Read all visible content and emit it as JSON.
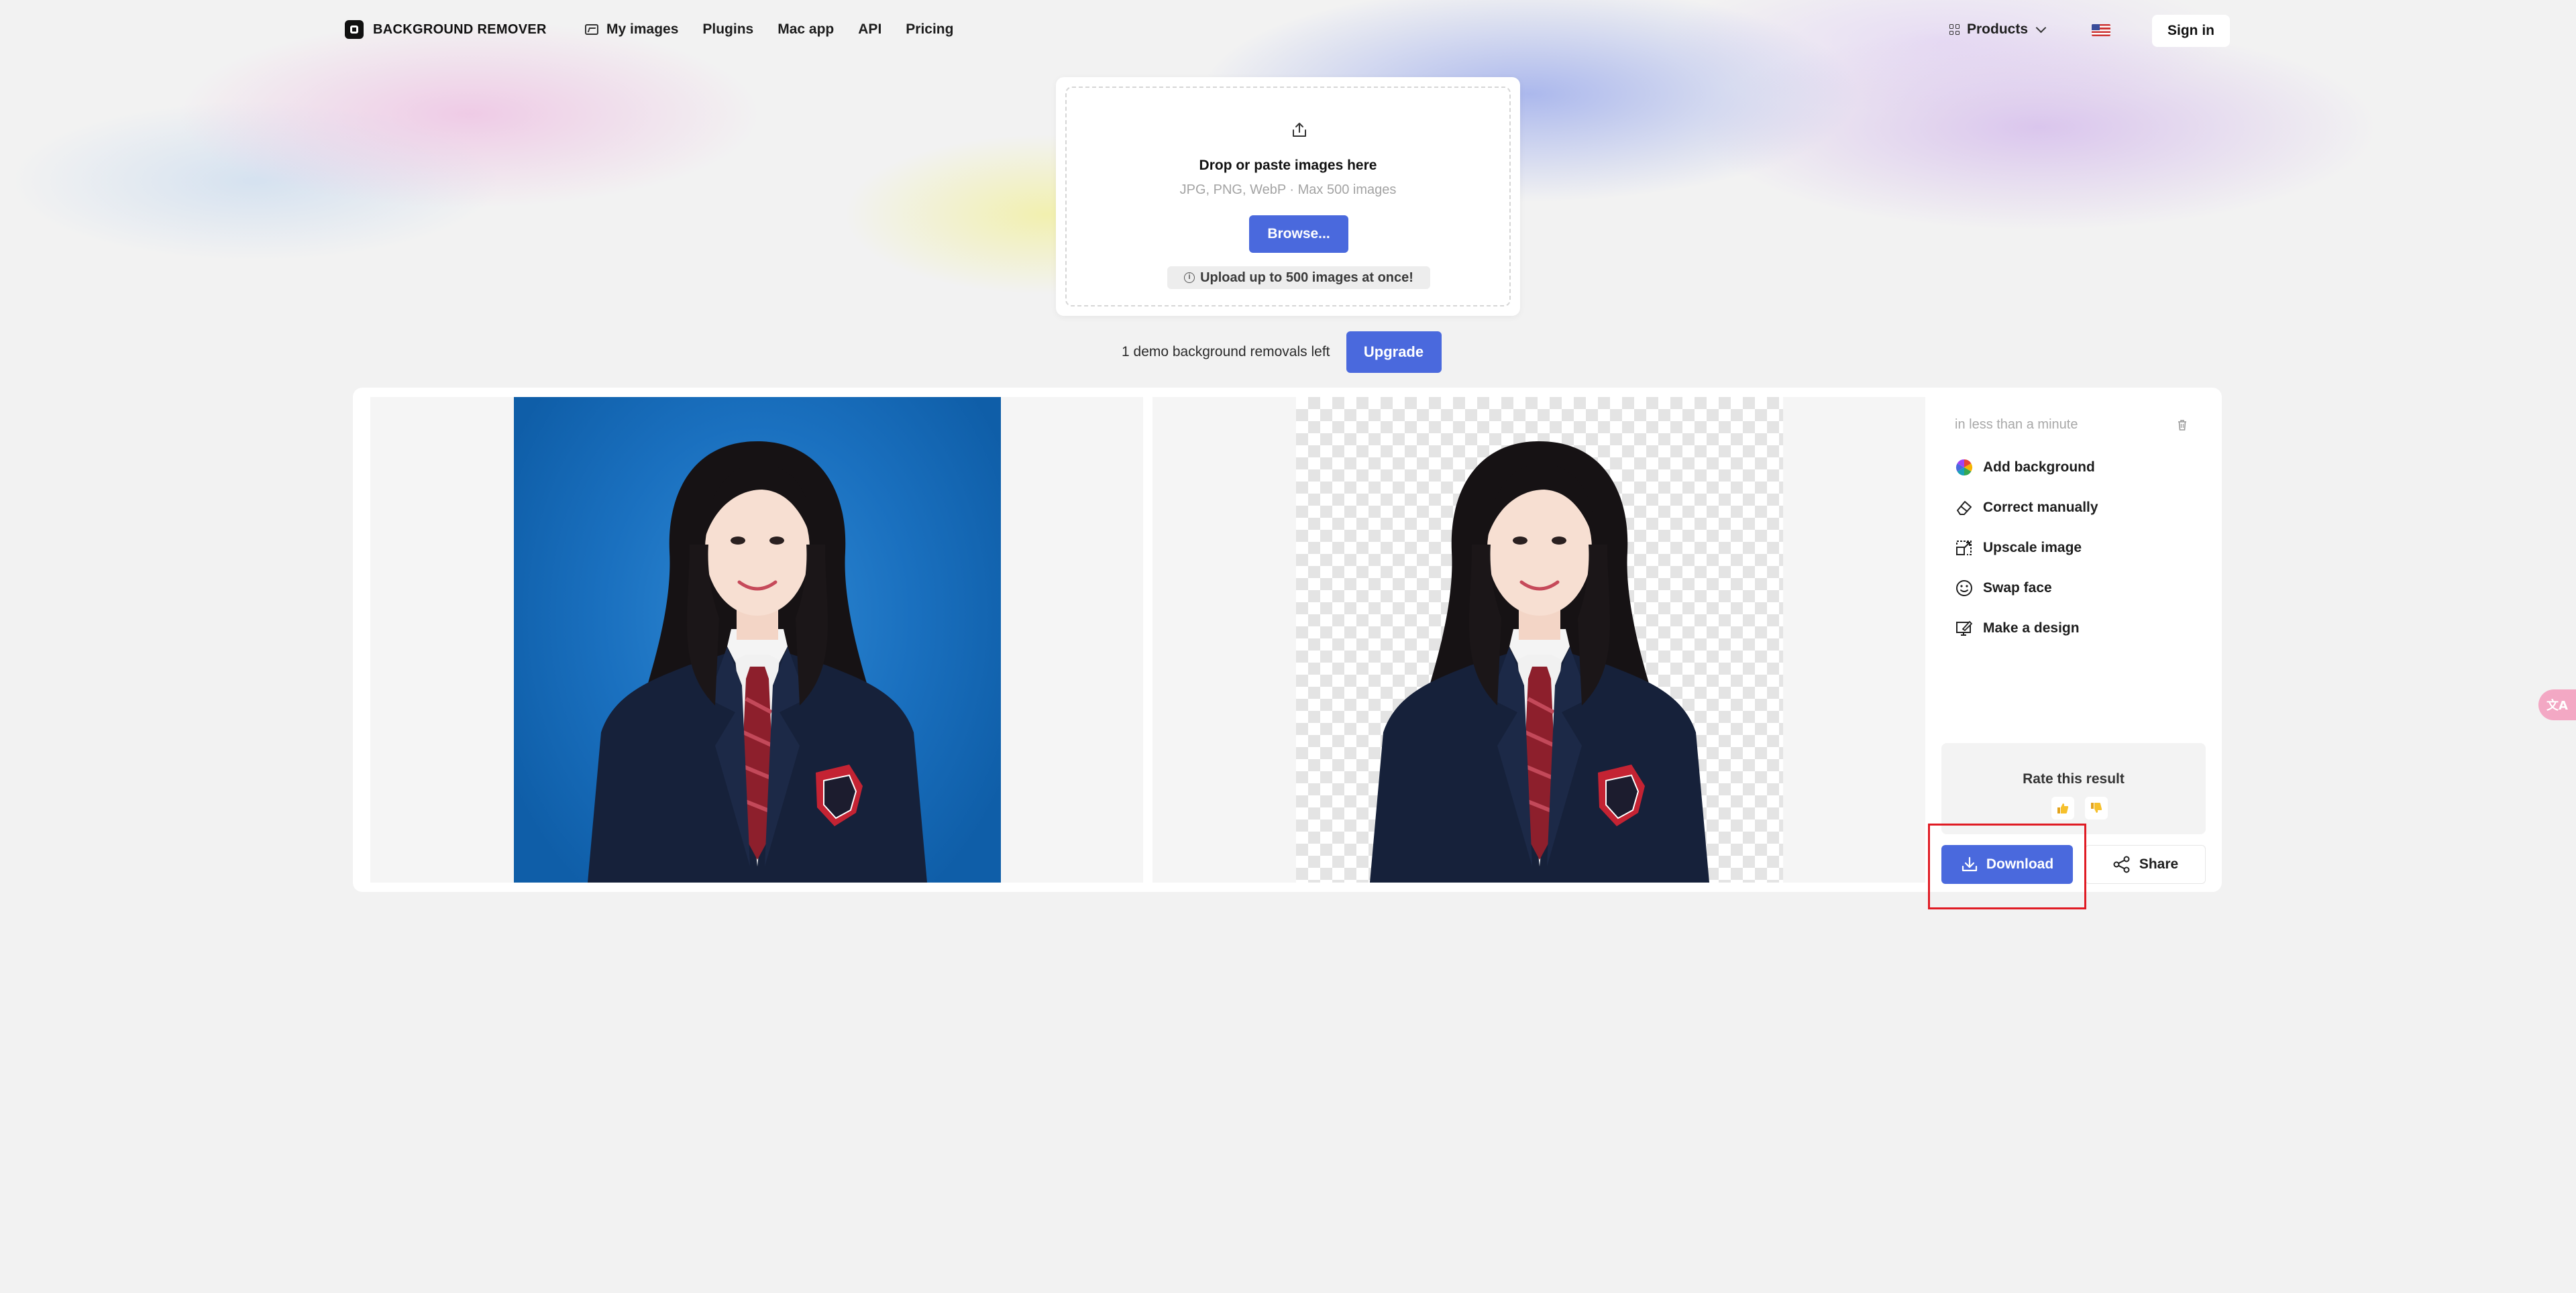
{
  "header": {
    "logo_text": "BACKGROUND REMOVER",
    "nav": [
      {
        "label": "My images",
        "icon": "image-icon"
      },
      {
        "label": "Plugins"
      },
      {
        "label": "Mac app"
      },
      {
        "label": "API"
      },
      {
        "label": "Pricing"
      }
    ],
    "products_label": "Products",
    "language_flag": "us-flag-icon",
    "signin_label": "Sign in"
  },
  "upload": {
    "title": "Drop or paste images here",
    "formats": "JPG, PNG, WebP · Max 500 images",
    "browse_label": "Browse...",
    "note": "Upload up to 500 images at once!"
  },
  "demo": {
    "remaining_text": "1 demo background removals left",
    "upgrade_label": "Upgrade"
  },
  "result": {
    "time_text": "in less than a minute",
    "actions": [
      {
        "label": "Add background",
        "icon": "color-wheel-icon"
      },
      {
        "label": "Correct manually",
        "icon": "eraser-icon"
      },
      {
        "label": "Upscale image",
        "icon": "upscale-icon"
      },
      {
        "label": "Swap face",
        "icon": "smile-icon"
      },
      {
        "label": "Make a design",
        "icon": "design-icon"
      }
    ],
    "rate_title": "Rate this result",
    "download_label": "Download",
    "share_label": "Share"
  },
  "colors": {
    "accent": "#4a69dd",
    "highlight": "#e01b24",
    "photo_background": "#1a70bf"
  },
  "widget": {
    "translate_glyph": "文A"
  }
}
